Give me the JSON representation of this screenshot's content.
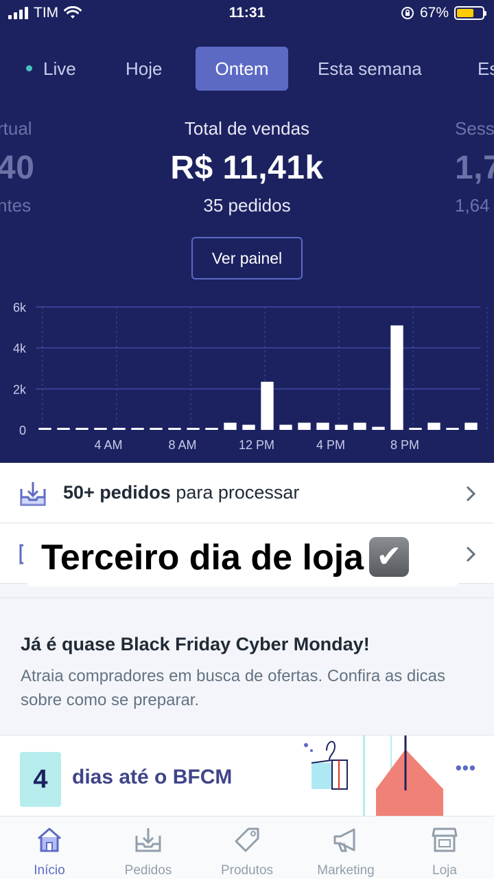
{
  "status_bar": {
    "carrier": "TIM",
    "time": "11:31",
    "battery": "67%",
    "battery_level": 0.67
  },
  "tabs": [
    "Live",
    "Hoje",
    "Ontem",
    "Esta semana",
    "Es"
  ],
  "active_tab": "Ontem",
  "stats": {
    "left": {
      "label": "rtual",
      "value": "40",
      "sub": "ntes"
    },
    "center": {
      "label": "Total de vendas",
      "value": "R$ 11,41k",
      "sub": "35 pedidos"
    },
    "right": {
      "label": "Sess",
      "value": "1,7",
      "sub": "1,64"
    }
  },
  "panel_button": "Ver painel",
  "chart_data": {
    "type": "bar",
    "y_ticks": [
      "6k",
      "4k",
      "2k",
      "0"
    ],
    "x_ticks": [
      "4 AM",
      "8 AM",
      "12 PM",
      "4 PM",
      "8 PM"
    ],
    "ylim": [
      0,
      6000
    ],
    "categories": [
      "0",
      "1",
      "2",
      "3",
      "4",
      "5",
      "6",
      "7",
      "8",
      "9",
      "10",
      "11",
      "12",
      "13",
      "14",
      "15",
      "16",
      "17",
      "18",
      "19",
      "20",
      "21",
      "22",
      "23"
    ],
    "values": [
      100,
      100,
      100,
      100,
      100,
      100,
      100,
      100,
      100,
      100,
      350,
      250,
      2350,
      250,
      350,
      350,
      250,
      350,
      150,
      5100,
      100,
      350,
      100,
      350
    ],
    "grid": true,
    "colors": {
      "bar": "#ffffff",
      "grid": "#3f4aa0"
    }
  },
  "orders_row": {
    "count": "50+ pedidos",
    "suffix": " para processar"
  },
  "overlay_caption": "Terceiro dia de loja",
  "overlay_emoji": "✔",
  "promo": {
    "title": "Já é quase Black Friday Cyber Monday!",
    "body": "Atraia compradores em busca de ofertas. Confira as dicas sobre como se preparar."
  },
  "bfcm": {
    "days": "4",
    "text": "dias até o BFCM",
    "more": "•••"
  },
  "nav": [
    {
      "label": "Início",
      "icon": "home-icon",
      "active": true
    },
    {
      "label": "Pedidos",
      "icon": "orders-icon",
      "active": false
    },
    {
      "label": "Produtos",
      "icon": "tag-icon",
      "active": false
    },
    {
      "label": "Marketing",
      "icon": "megaphone-icon",
      "active": false
    },
    {
      "label": "Loja",
      "icon": "store-icon",
      "active": false
    }
  ],
  "colors": {
    "hero_bg": "#1c2260",
    "accent": "#5c6ac4",
    "teal": "#47c1bf",
    "battery": "#ffcc00"
  }
}
